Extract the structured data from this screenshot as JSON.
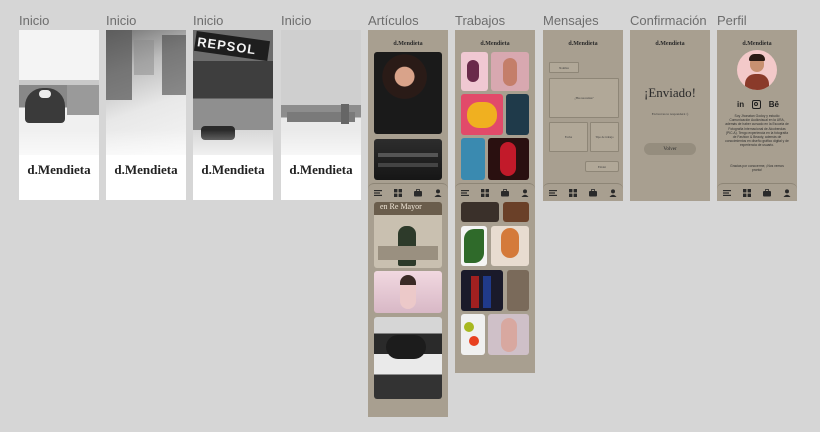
{
  "frames": [
    {
      "label": "Inicio"
    },
    {
      "label": "Inicio"
    },
    {
      "label": "Inicio"
    },
    {
      "label": "Inicio"
    },
    {
      "label": "Artículos"
    },
    {
      "label": "Trabajos"
    },
    {
      "label": "Mensajes"
    },
    {
      "label": "Confirmación"
    },
    {
      "label": "Perfil"
    }
  ],
  "brand": "d.Mendieta",
  "splash_brand": "d.Mendieta",
  "photos": {
    "repsol_sign": "REPSOL",
    "article_caption": "en Re Mayor"
  },
  "mensajes": {
    "name_placeholder": "Nombre",
    "message_placeholder": "¿Has necesitas?",
    "date_placeholder": "Fecha",
    "type_placeholder": "Tipo de trabajo",
    "send_label": "Enviar"
  },
  "confirmacion": {
    "headline": "¡Enviado!",
    "body": "En breves te responderé :)",
    "back_label": "Volver"
  },
  "perfil": {
    "social": [
      "in",
      "Bē"
    ],
    "bio": "Soy Jhonatan Godoy y estudio Comunicación Audiovisual en la URA, además de haber cursado en la Escuela de Fotografía Internacional de Alcobendas (PIC.A). Tengo experiencia en la fotografía de Fashion & Beauty, además de conocimientos en diseño gráfico digital y de experiencia de usuario.",
    "thanks": "Gracias por conocerme, ¡Nos vemos pronto!"
  },
  "tabs": [
    "articles-tab",
    "works-tab",
    "messages-tab",
    "profile-tab"
  ],
  "colors": {
    "canvas": "#d6d6d6",
    "app_bg": "#a89f90",
    "label": "#6d6d6d",
    "ink": "#2a2a2a"
  }
}
